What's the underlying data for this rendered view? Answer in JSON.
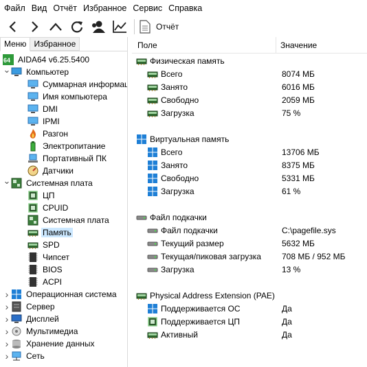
{
  "menubar": [
    "Файл",
    "Вид",
    "Отчёт",
    "Избранное",
    "Сервис",
    "Справка"
  ],
  "toolbar": {
    "report_label": "Отчёт",
    "buttons": [
      "back-icon",
      "forward-icon",
      "up-icon",
      "refresh-icon",
      "user-icon",
      "chart-icon"
    ]
  },
  "tabs": {
    "menu": "Меню",
    "favorites": "Избранное"
  },
  "tree": [
    {
      "label": "AIDA64 v6.25.5400",
      "level": 0,
      "icon": "aida64-icon"
    },
    {
      "label": "Компьютер",
      "level": 0,
      "icon": "computer-icon",
      "expanded": true
    },
    {
      "label": "Суммарная информация",
      "level": 1,
      "icon": "monitor-icon"
    },
    {
      "label": "Имя компьютера",
      "level": 1,
      "icon": "monitor-icon"
    },
    {
      "label": "DMI",
      "level": 1,
      "icon": "monitor-icon"
    },
    {
      "label": "IPMI",
      "level": 1,
      "icon": "monitor-icon"
    },
    {
      "label": "Разгон",
      "level": 1,
      "icon": "flame-icon"
    },
    {
      "label": "Электропитание",
      "level": 1,
      "icon": "battery-icon"
    },
    {
      "label": "Портативный ПК",
      "level": 1,
      "icon": "laptop-icon"
    },
    {
      "label": "Датчики",
      "level": 1,
      "icon": "gauge-icon"
    },
    {
      "label": "Системная плата",
      "level": 0,
      "icon": "motherboard-icon",
      "expanded": true
    },
    {
      "label": "ЦП",
      "level": 1,
      "icon": "cpu-icon"
    },
    {
      "label": "CPUID",
      "level": 1,
      "icon": "cpu-icon"
    },
    {
      "label": "Системная плата",
      "level": 1,
      "icon": "motherboard-icon"
    },
    {
      "label": "Память",
      "level": 1,
      "icon": "ram-icon",
      "selected": true
    },
    {
      "label": "SPD",
      "level": 1,
      "icon": "ram-icon"
    },
    {
      "label": "Чипсет",
      "level": 1,
      "icon": "chip-icon"
    },
    {
      "label": "BIOS",
      "level": 1,
      "icon": "chip-icon"
    },
    {
      "label": "ACPI",
      "level": 1,
      "icon": "chip-icon"
    },
    {
      "label": "Операционная система",
      "level": 0,
      "icon": "windows-icon",
      "collapsed": true
    },
    {
      "label": "Сервер",
      "level": 0,
      "icon": "server-icon",
      "collapsed": true
    },
    {
      "label": "Дисплей",
      "level": 0,
      "icon": "display-icon",
      "collapsed": true
    },
    {
      "label": "Мультимедиа",
      "level": 0,
      "icon": "multimedia-icon",
      "collapsed": true
    },
    {
      "label": "Хранение данных",
      "level": 0,
      "icon": "storage-icon",
      "collapsed": true
    },
    {
      "label": "Сеть",
      "level": 0,
      "icon": "network-icon",
      "collapsed": true
    }
  ],
  "columns": {
    "field": "Поле",
    "value": "Значение"
  },
  "sections": [
    {
      "title": "Физическая память",
      "icon": "ram-icon",
      "rows": [
        {
          "field": "Всего",
          "value": "8074 МБ",
          "icon": "ram-icon"
        },
        {
          "field": "Занято",
          "value": "6016 МБ",
          "icon": "ram-icon"
        },
        {
          "field": "Свободно",
          "value": "2059 МБ",
          "icon": "ram-icon"
        },
        {
          "field": "Загрузка",
          "value": "75 %",
          "icon": "ram-icon"
        }
      ]
    },
    {
      "title": "Виртуальная память",
      "icon": "windows-icon",
      "rows": [
        {
          "field": "Всего",
          "value": "13706 МБ",
          "icon": "windows-icon"
        },
        {
          "field": "Занято",
          "value": "8375 МБ",
          "icon": "windows-icon"
        },
        {
          "field": "Свободно",
          "value": "5331 МБ",
          "icon": "windows-icon"
        },
        {
          "field": "Загрузка",
          "value": "61 %",
          "icon": "windows-icon"
        }
      ]
    },
    {
      "title": "Файл подкачки",
      "icon": "disk-icon",
      "rows": [
        {
          "field": "Файл подкачки",
          "value": "C:\\pagefile.sys",
          "icon": "disk-icon"
        },
        {
          "field": "Текущий размер",
          "value": "5632 МБ",
          "icon": "disk-icon"
        },
        {
          "field": "Текущая/пиковая загрузка",
          "value": "708 МБ / 952 МБ",
          "icon": "disk-icon"
        },
        {
          "field": "Загрузка",
          "value": "13 %",
          "icon": "disk-icon"
        }
      ]
    },
    {
      "title": "Physical Address Extension (PAE)",
      "icon": "ram-icon",
      "rows": [
        {
          "field": "Поддерживается ОС",
          "value": "Да",
          "icon": "windows-icon"
        },
        {
          "field": "Поддерживается ЦП",
          "value": "Да",
          "icon": "cpu-icon"
        },
        {
          "field": "Активный",
          "value": "Да",
          "icon": "ram-icon"
        }
      ]
    }
  ]
}
